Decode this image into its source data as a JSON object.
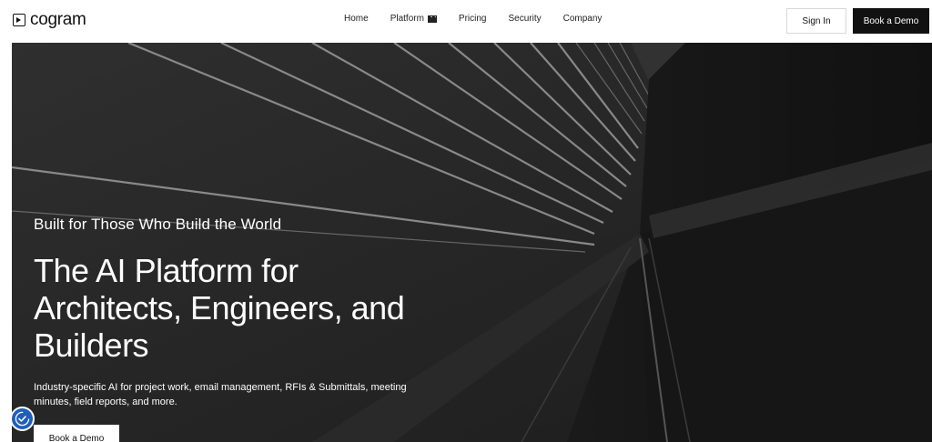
{
  "header": {
    "logo_text": "cogram",
    "nav": [
      {
        "label": "Home"
      },
      {
        "label": "Platform"
      },
      {
        "label": "Pricing"
      },
      {
        "label": "Security"
      },
      {
        "label": "Company"
      }
    ],
    "platform_icon": "clapper-board-icon",
    "sign_in_label": "Sign In",
    "book_demo_label": "Book a Demo"
  },
  "hero": {
    "tagline": "Built for Those Who Build the World",
    "headline_line1": "The AI Platform for",
    "headline_line2": "Architects, Engineers, and",
    "headline_line3": "Builders",
    "description": "Industry-specific AI for project work, email management, RFIs & Submittals, meeting minutes, field reports, and more.",
    "cta_label": "Book a Demo",
    "background": "bridge-cables-photo"
  },
  "accessibility_widget": {
    "icon": "accessibility-icon",
    "color": "#1f5fb8"
  },
  "colors": {
    "header_bg": "#ffffff",
    "hero_bg": "#262626",
    "primary_button": "#111111"
  }
}
